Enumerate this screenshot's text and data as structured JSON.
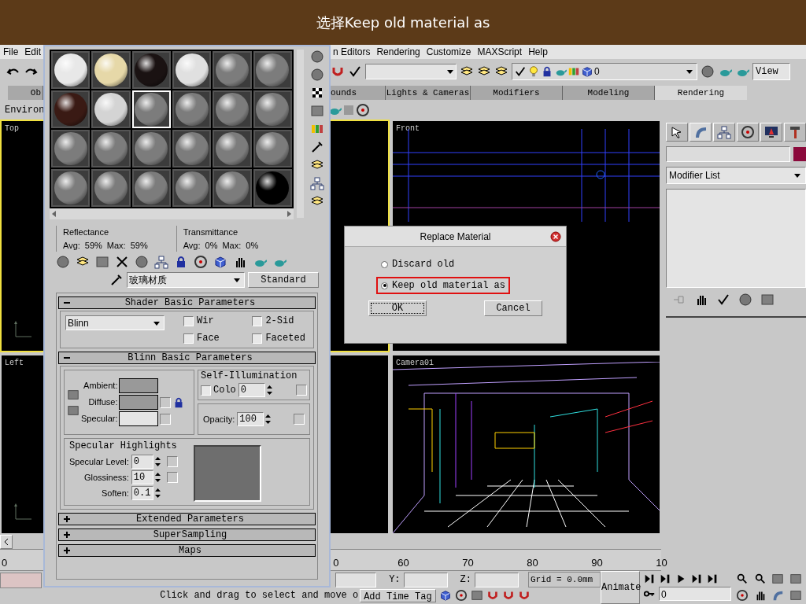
{
  "banner": {
    "title": "选择Keep old material as"
  },
  "menu": [
    "File",
    "Edit",
    "n Editors",
    "Rendering",
    "Customize",
    "MAXScript",
    "Help"
  ],
  "toolbar": {
    "layer": "0",
    "view": "View"
  },
  "tabs": [
    {
      "label": "Ob",
      "selected": false
    },
    {
      "label": "ounds",
      "selected": false
    },
    {
      "label": "Lights & Cameras",
      "selected": false
    },
    {
      "label": "Modifiers",
      "selected": false
    },
    {
      "label": "Modeling",
      "selected": false
    },
    {
      "label": "Rendering",
      "selected": true
    }
  ],
  "tab_panel_label": "Environ",
  "viewports": [
    {
      "label": "Top",
      "active": true,
      "kind": "top"
    },
    {
      "label": "Front",
      "active": false,
      "kind": "front"
    },
    {
      "label": "Left",
      "active": false,
      "kind": "left"
    },
    {
      "label": "Camera01",
      "active": false,
      "kind": "camera"
    }
  ],
  "command_panel": {
    "object_swatch": {
      "color": "#8b0a3c"
    },
    "modifier_list": "Modifier List"
  },
  "timeline": {
    "first_tick": "0",
    "ticks": [
      "0",
      "60",
      "70",
      "80",
      "90",
      "10"
    ]
  },
  "status": {
    "y_label": "Y:",
    "z_label": "Z:",
    "grid": "Grid = 0.0mm",
    "animate": "Animate",
    "prompt": "Click and drag to select and move o",
    "time_tag": "Add Time Tag",
    "frame": "0"
  },
  "material_editor": {
    "slots": [
      {
        "color": "#e8e8e8",
        "selected": false
      },
      {
        "color": "#e6d8a8",
        "selected": false
      },
      {
        "color": "#1a1212",
        "selected": false
      },
      {
        "color": "#e0e0e0",
        "selected": false
      },
      {
        "color": "#7c7c7c",
        "selected": false
      },
      {
        "color": "#7c7c7c",
        "selected": false
      },
      {
        "color": "#3a1a14",
        "selected": false
      },
      {
        "color": "#d4d4d4",
        "selected": false
      },
      {
        "color": "#7c7c7c",
        "selected": true
      },
      {
        "color": "#7c7c7c",
        "selected": false
      },
      {
        "color": "#7c7c7c",
        "selected": false
      },
      {
        "color": "#7c7c7c",
        "selected": false
      },
      {
        "color": "#7c7c7c",
        "selected": false
      },
      {
        "color": "#7c7c7c",
        "selected": false
      },
      {
        "color": "#7c7c7c",
        "selected": false
      },
      {
        "color": "#7c7c7c",
        "selected": false
      },
      {
        "color": "#7c7c7c",
        "selected": false
      },
      {
        "color": "#7c7c7c",
        "selected": false
      },
      {
        "color": "#7c7c7c",
        "selected": false
      },
      {
        "color": "#7c7c7c",
        "selected": false
      },
      {
        "color": "#7c7c7c",
        "selected": false
      },
      {
        "color": "#7c7c7c",
        "selected": false
      },
      {
        "color": "#7c7c7c",
        "selected": false
      },
      {
        "color": "#000000",
        "selected": false
      }
    ],
    "reflectance": {
      "title": "Reflectance",
      "avg_label": "Avg:",
      "avg": "59%",
      "max_label": "Max:",
      "max": "59%"
    },
    "transmittance": {
      "title": "Transmittance",
      "avg_label": "Avg:",
      "avg": "0%",
      "max_label": "Max:",
      "max": "0%"
    },
    "material_name": "玻璃材质",
    "material_type": "Standard",
    "shader": {
      "title": "Shader Basic Parameters",
      "expanded": true,
      "shader": "Blinn",
      "options": [
        {
          "label": "Wir",
          "checked": false
        },
        {
          "label": "2-Sid",
          "checked": false
        },
        {
          "label": "Face",
          "checked": false
        },
        {
          "label": "Faceted",
          "checked": false
        }
      ]
    },
    "blinn": {
      "title": "Blinn Basic Parameters",
      "expanded": true,
      "colors": [
        {
          "label": "Ambient:",
          "color": "#999999"
        },
        {
          "label": "Diffuse:",
          "color": "#999999"
        },
        {
          "label": "Specular:",
          "color": "#e5e5e5"
        }
      ],
      "self_illum_title": "Self-Illumination",
      "self_illum_label": "Colo",
      "self_illum_checked": false,
      "self_illum_value": "0",
      "opacity_label": "Opacity:",
      "opacity": "100",
      "highlights_title": "Specular Highlights",
      "highlights": [
        {
          "label": "Specular Level:",
          "value": "0"
        },
        {
          "label": "Glossiness:",
          "value": "10"
        },
        {
          "label": "Soften:",
          "value": "0.1"
        }
      ]
    },
    "collapsed": [
      {
        "title": "Extended Parameters",
        "expanded": false
      },
      {
        "title": "SuperSampling",
        "expanded": false
      },
      {
        "title": "Maps",
        "expanded": false
      }
    ]
  },
  "dialog": {
    "title": "Replace Material",
    "options": [
      {
        "label": "Discard old",
        "selected": false,
        "highlighted": false
      },
      {
        "label": "Keep old material as",
        "selected": true,
        "highlighted": true
      }
    ],
    "buttons": [
      "OK",
      "Cancel"
    ]
  }
}
